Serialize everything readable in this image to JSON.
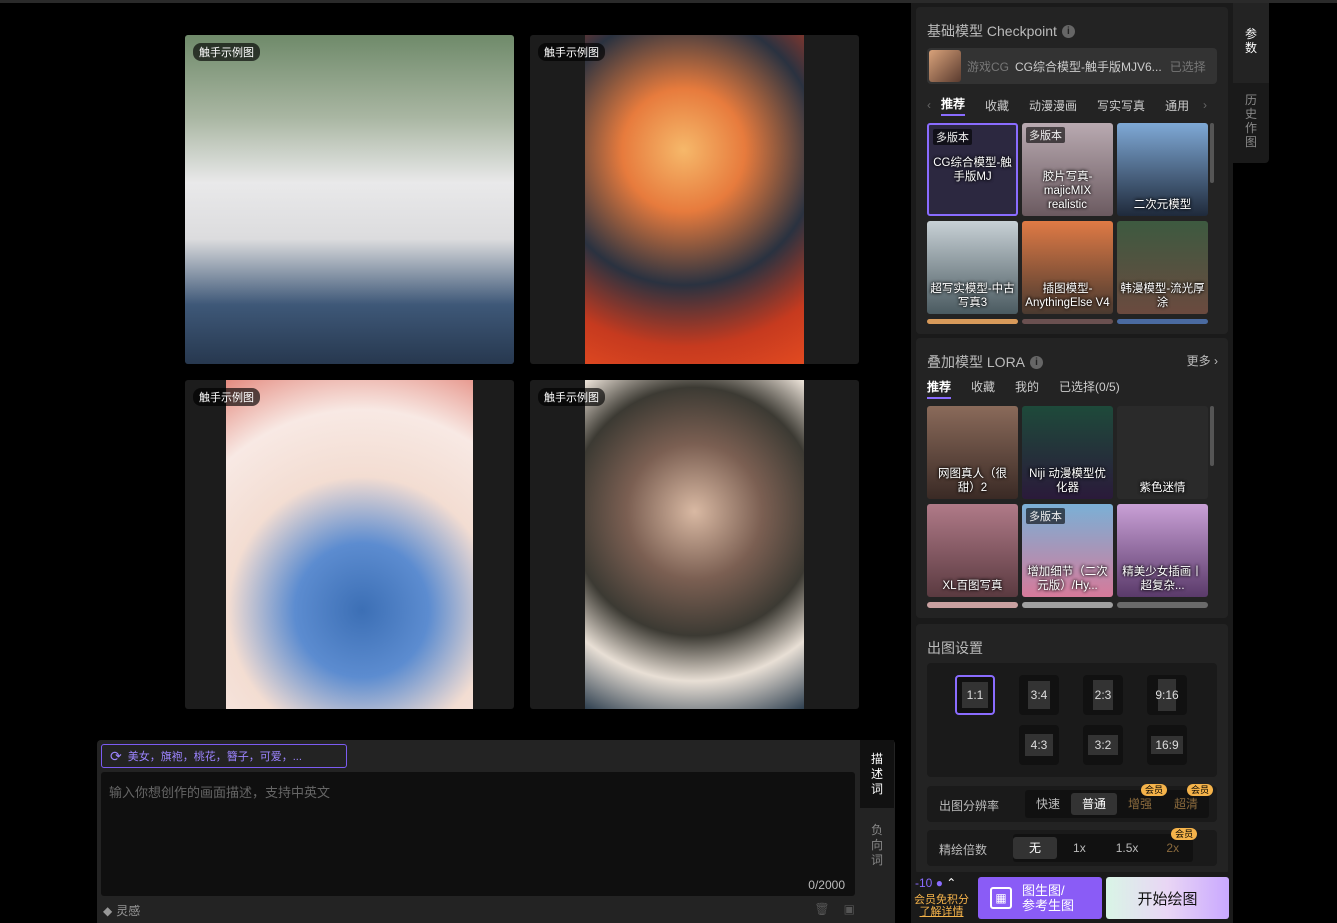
{
  "gallery": {
    "tag": "触手示例图"
  },
  "prompt": {
    "chip_text": "美女，旗袍，桃花，簪子，可爱，...",
    "placeholder": "输入你想创作的画面描述，支持中英文",
    "counter": "0/2000",
    "tab_describe": [
      "描",
      "述",
      "词"
    ],
    "tab_negative": [
      "负",
      "向",
      "词"
    ],
    "inspiration": "灵感"
  },
  "side_tabs": {
    "params": [
      "参",
      "数"
    ],
    "history": [
      "历",
      "史",
      "作",
      "图"
    ]
  },
  "checkpoint": {
    "title": "基础模型 Checkpoint",
    "tag": "游戏CG",
    "name": "CG综合模型-触手版MJV6...",
    "selected": "已选择",
    "categories": [
      "推荐",
      "收藏",
      "动漫漫画",
      "写实写真",
      "通用"
    ],
    "models": [
      {
        "label": "CG综合模型-触手版MJ",
        "badge": "多版本"
      },
      {
        "label": "胶片写真-majicMIX realistic",
        "badge": "多版本"
      },
      {
        "label": "二次元模型",
        "badge": ""
      },
      {
        "label": "超写实模型-中古写真3",
        "badge": ""
      },
      {
        "label": "插图模型-AnythingElse V4",
        "badge": ""
      },
      {
        "label": "韩漫模型-流光厚涂",
        "badge": ""
      }
    ]
  },
  "lora": {
    "title": "叠加模型 LORA",
    "more": "更多",
    "categories": [
      "推荐",
      "收藏",
      "我的",
      "已选择(0/5)"
    ],
    "models": [
      {
        "label": "网图真人（很甜）2",
        "badge": ""
      },
      {
        "label": "Niji 动漫模型优化器",
        "badge": ""
      },
      {
        "label": "紫色迷情",
        "badge": ""
      },
      {
        "label": "XL百图写真",
        "badge": ""
      },
      {
        "label": "增加细节（二次元版）/Hy...",
        "badge": "多版本"
      },
      {
        "label": "精美少女插画丨超复杂...",
        "badge": ""
      }
    ]
  },
  "output": {
    "title": "出图设置",
    "ratios": [
      "1:1",
      "3:4",
      "2:3",
      "9:16",
      "4:3",
      "3:2",
      "16:9"
    ],
    "selected_ratio": "1:1",
    "resolution_label": "出图分辨率",
    "resolution_options": [
      "快速",
      "普通",
      "增强",
      "超清"
    ],
    "refine_label": "精绘倍数",
    "refine_options": [
      "无",
      "1x",
      "1.5x",
      "2x"
    ],
    "vip": "会员"
  },
  "footer": {
    "cost": "-10",
    "vip_line1": "会员免积分",
    "vip_line2": "了解详情",
    "img2img": [
      "图生图/",
      "参考生图"
    ],
    "generate": "开始绘图"
  },
  "colors": {
    "accent": "#8a5cf6",
    "vip": "#f5b34a"
  }
}
